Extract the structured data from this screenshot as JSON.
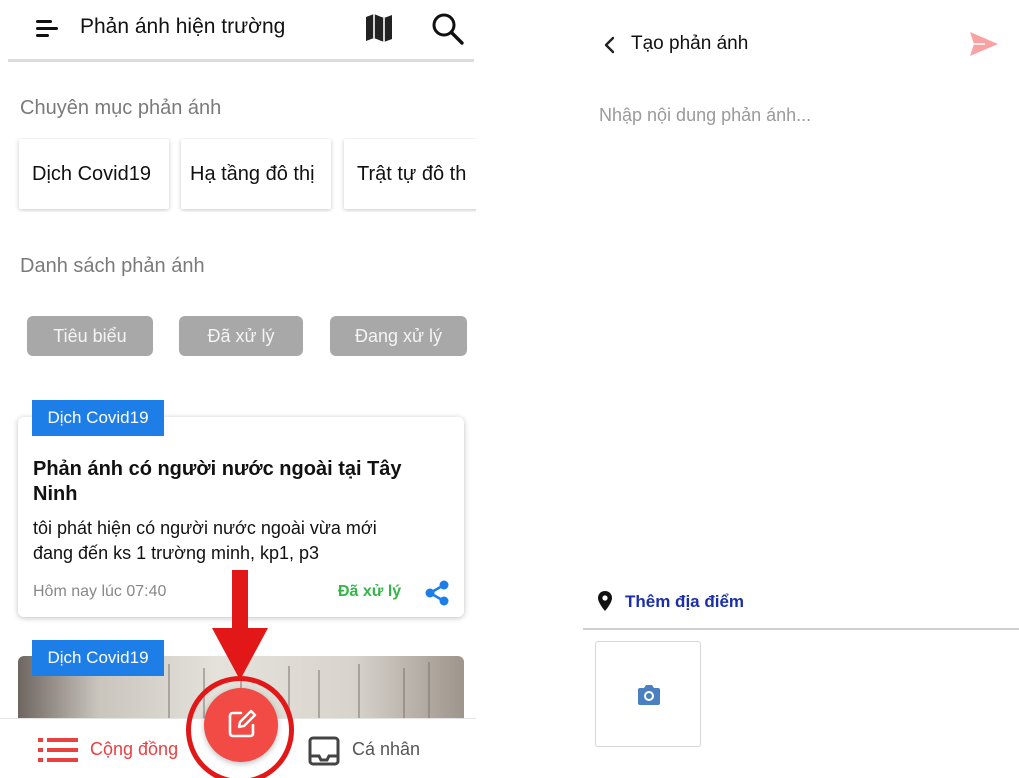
{
  "left_screen": {
    "header": {
      "title": "Phản ánh hiện trường"
    },
    "categories_section": {
      "title": "Chuyên mục phản ánh"
    },
    "categories": [
      "Dịch Covid19",
      "Hạ tầng đô thị",
      "Trật tự đô th"
    ],
    "list_section": {
      "title": "Danh sách phản ánh"
    },
    "filters": [
      "Tiêu biểu",
      "Đã xử lý",
      "Đang xử lý"
    ],
    "posts": [
      {
        "tag": "Dịch Covid19",
        "title": "Phản ánh có người nước ngoài tại Tây Ninh",
        "body": "tôi phát hiện có người nước ngoài vừa mới đang đến ks 1 trường minh, kp1, p3",
        "time": "Hôm nay lúc 07:40",
        "status": "Đã xử lý"
      },
      {
        "tag": "Dịch Covid19"
      }
    ],
    "bottom_nav": {
      "community": "Cộng đồng",
      "personal": "Cá nhân"
    },
    "icons": [
      "hamburger-icon",
      "map-icon",
      "search-icon",
      "share-icon",
      "list-icon",
      "edit-icon",
      "inbox-icon"
    ]
  },
  "right_screen": {
    "header": {
      "title": "Tạo phản ánh"
    },
    "content": {
      "placeholder": "Nhập nội dung phản ánh..."
    },
    "add_location": "Thêm địa điểm",
    "icons": [
      "back-icon",
      "send-icon",
      "location-pin-icon",
      "camera-icon"
    ]
  },
  "colors": {
    "accent_red": "#f24a44",
    "highlight_red": "#e21818",
    "tag_blue": "#1e7ee8",
    "status_green": "#36b44a",
    "link_blue": "#1b2fa8",
    "send_pink": "#f7a3a3",
    "chip_gray": "#a8a8a8"
  }
}
